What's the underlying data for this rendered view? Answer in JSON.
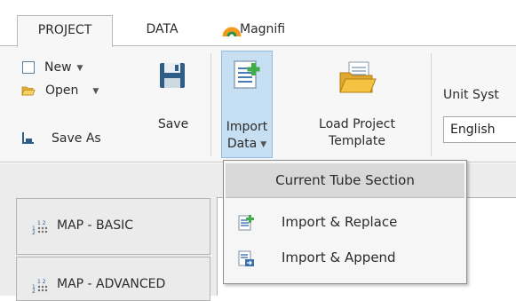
{
  "tabs": [
    {
      "label": "PROJECT",
      "active": true
    },
    {
      "label": "DATA",
      "active": false
    },
    {
      "label": "Magnifi",
      "active": false
    }
  ],
  "ribbon": {
    "new_label": "New",
    "open_label": "Open",
    "save_as_label": "Save As",
    "save_label": "Save",
    "import_line1": "Import",
    "import_line2": "Data",
    "load_line1": "Load Project",
    "load_line2": "Template",
    "unit_system_label": "Unit Syst",
    "unit_system_value": "English"
  },
  "nav": {
    "basic_label": "MAP - BASIC",
    "advanced_label": "MAP - ADVANCED"
  },
  "dropdown": {
    "header": "Current Tube Section",
    "items": [
      {
        "label": "Import & Replace",
        "icon": "import-replace-icon"
      },
      {
        "label": "Import & Append",
        "icon": "import-append-icon"
      }
    ]
  },
  "colors": {
    "accent_highlight": "#c6dff2",
    "accent_border": "#92bde3",
    "magnifi_orange": "#f39a1c",
    "folder_yellow": "#f5c242",
    "import_green": "#3fae49"
  }
}
